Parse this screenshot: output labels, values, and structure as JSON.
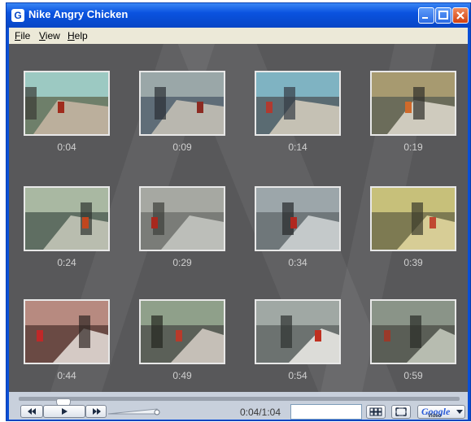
{
  "window": {
    "title": "Nike Angry Chicken",
    "app_icon": "G",
    "title_buttons": [
      "minimize-icon",
      "maximize-icon",
      "close-icon"
    ]
  },
  "menu": {
    "file": {
      "first": "F",
      "rest": "ile"
    },
    "view": {
      "first": "V",
      "rest": "iew"
    },
    "help": {
      "first": "H",
      "rest": "elp"
    }
  },
  "thumbnails": [
    {
      "time": "0:04",
      "palette": [
        "#6e7f6a",
        "#9cc9c2",
        "#c9b7a4",
        "#3b3a36",
        "#a02b1c"
      ]
    },
    {
      "time": "0:09",
      "palette": [
        "#5f6d78",
        "#9aa7a8",
        "#c9c4b8",
        "#2b2f35",
        "#8c2a22"
      ]
    },
    {
      "time": "0:14",
      "palette": [
        "#5a6b72",
        "#7fb3c2",
        "#d8d0c0",
        "#343c44",
        "#b03a30"
      ]
    },
    {
      "time": "0:19",
      "palette": [
        "#6b6c5a",
        "#a79a70",
        "#e0dcd0",
        "#2d2e2a",
        "#d06a2a"
      ]
    },
    {
      "time": "0:24",
      "palette": [
        "#5f6e62",
        "#a9b8a2",
        "#c9cbbd",
        "#2f3430",
        "#c0461e"
      ]
    },
    {
      "time": "0:29",
      "palette": [
        "#7a7c78",
        "#a6a8a2",
        "#c8cac4",
        "#3d3f3b",
        "#a8281e"
      ]
    },
    {
      "time": "0:34",
      "palette": [
        "#6f777a",
        "#9ca6aa",
        "#d3d7d8",
        "#26292b",
        "#b02820"
      ]
    },
    {
      "time": "0:39",
      "palette": [
        "#7d7a52",
        "#c7c07a",
        "#e6dca2",
        "#3b3a2b",
        "#c04830"
      ]
    },
    {
      "time": "0:44",
      "palette": [
        "#6a4a44",
        "#b78a80",
        "#e8e0dc",
        "#2f2624",
        "#c02828"
      ]
    },
    {
      "time": "0:49",
      "palette": [
        "#5b6058",
        "#8fa08a",
        "#d8d0c8",
        "#242620",
        "#b83a2a"
      ]
    },
    {
      "time": "0:54",
      "palette": [
        "#6c7270",
        "#a0a8a4",
        "#f0eeea",
        "#2e3230",
        "#c03020"
      ]
    },
    {
      "time": "0:59",
      "palette": [
        "#5a5e56",
        "#8a9488",
        "#c8ccc0",
        "#2a2c28",
        "#9a3a2a"
      ]
    }
  ],
  "controls": {
    "rewind_icon": "rewind-icon",
    "play_icon": "play-icon",
    "forward_icon": "fast-forward-icon",
    "time_display": "0:04/1:04",
    "search_value": "",
    "grid_icon": "grid-view-icon",
    "fullscreen_icon": "fullscreen-icon",
    "google": {
      "brand": "Google",
      "sub": "Video"
    },
    "seek_progress": 0.0625
  },
  "colors": {
    "titlebar": "#0a52df",
    "menubar": "#ece9d8",
    "content_bg": "#58585a",
    "controls_bg": "#c8d0dc"
  }
}
